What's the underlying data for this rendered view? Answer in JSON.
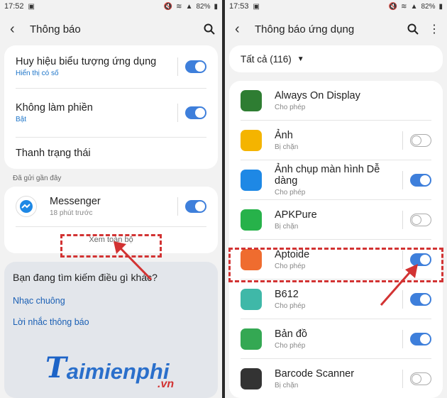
{
  "left": {
    "status": {
      "time": "17:52",
      "battery": "82%"
    },
    "title": "Thông báo",
    "settings": [
      {
        "label": "Huy hiệu biểu tượng ứng dụng",
        "sub": "Hiển thị có số",
        "toggle": true
      },
      {
        "label": "Không làm phiền",
        "sub": "Bật",
        "toggle": true
      },
      {
        "label": "Thanh trạng thái"
      }
    ],
    "recent_label": "Đã gửi gần đây",
    "recent_app": {
      "name": "Messenger",
      "time": "18 phút trước",
      "toggle": true
    },
    "see_all": "Xem toàn bộ",
    "help": {
      "question": "Bạn đang tìm kiếm điều gì khác?",
      "links": [
        "Nhạc chuông",
        "Lời nhắc thông báo"
      ]
    },
    "watermark": {
      "brand": "aimienphi",
      "brand_initial": "T",
      "tld": ".vn"
    }
  },
  "right": {
    "status": {
      "time": "17:53",
      "battery": "82%"
    },
    "title": "Thông báo ứng dụng",
    "filter": "Tất cả (116)",
    "apps": [
      {
        "name": "Always On Display",
        "status": "Cho phép",
        "toggle": null,
        "icon": "clock-icon",
        "color": "#2e7d32"
      },
      {
        "name": "Ảnh",
        "status": "Bị chặn",
        "toggle": false,
        "icon": "pinwheel-icon",
        "color": "#f4b400"
      },
      {
        "name": "Ảnh chụp màn hình Dễ dàng",
        "status": "Cho phép",
        "toggle": true,
        "icon": "camera-icon",
        "color": "#1e88e5"
      },
      {
        "name": "APKPure",
        "status": "Bị chặn",
        "toggle": false,
        "icon": "apkpure-icon",
        "color": "#27b24a"
      },
      {
        "name": "Aptoide",
        "status": "Cho phép",
        "toggle": true,
        "icon": "aptoide-icon",
        "color": "#ef6c2f"
      },
      {
        "name": "B612",
        "status": "Cho phép",
        "toggle": true,
        "icon": "b612-icon",
        "color": "#3fb8a8"
      },
      {
        "name": "Bản đồ",
        "status": "Cho phép",
        "toggle": true,
        "icon": "maps-pin-icon",
        "color": "#34a853"
      },
      {
        "name": "Barcode Scanner",
        "status": "Bị chặn",
        "toggle": false,
        "icon": "barcode-icon",
        "color": "#333333"
      }
    ]
  },
  "colors": {
    "toggle_on": "#3e7fdb",
    "highlight": "#d23333",
    "link": "#1a73c8"
  }
}
